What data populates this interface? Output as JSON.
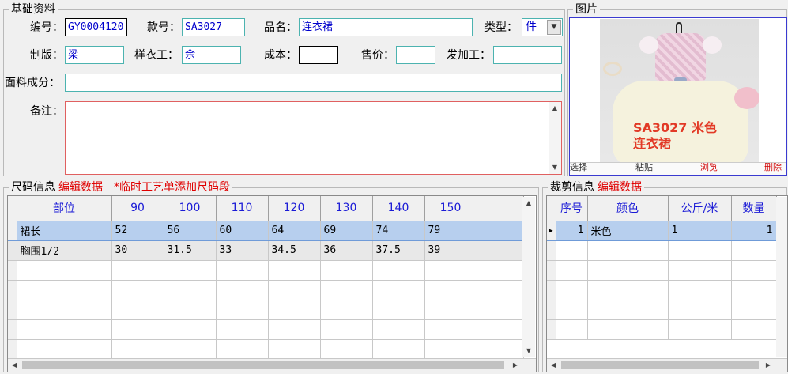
{
  "basic": {
    "title": "基础资料",
    "code_label": "编号：",
    "code_value": "GY0004120",
    "style_label": "款号：",
    "style_value": "SA3027",
    "name_label": "品名：",
    "name_value": "连衣裙",
    "type_label": "类型：",
    "type_value": "件",
    "pattern_label": "制版：",
    "pattern_value": "梁",
    "sample_label": "样衣工：",
    "sample_value": "余",
    "cost_label": "成本：",
    "cost_value": "",
    "price_label": "售价：",
    "price_value": "",
    "processor_label": "发加工：",
    "processor_value": "",
    "fabric_label": "面料成分：",
    "fabric_value": "",
    "notes_label": "备注：",
    "notes_value": ""
  },
  "photo": {
    "title": "图片",
    "caption_line1": "SA3027  米色",
    "caption_line2": "连衣裙",
    "buttons": {
      "select": "选择",
      "paste": "粘贴",
      "browse": "浏览",
      "delete": "删除"
    }
  },
  "size_info": {
    "title": "尺码信息",
    "edit_link": "编辑数据",
    "note": "*临时工艺单添加尺码段",
    "columns": [
      "部位",
      "90",
      "100",
      "110",
      "120",
      "130",
      "140",
      "150"
    ],
    "rows": [
      [
        "裙长",
        "52",
        "56",
        "60",
        "64",
        "69",
        "74",
        "79"
      ],
      [
        "胸围1/2",
        "30",
        "31.5",
        "33",
        "34.5",
        "36",
        "37.5",
        "39"
      ]
    ]
  },
  "cut_info": {
    "title": "裁剪信息",
    "edit_link": "编辑数据",
    "columns": [
      "序号",
      "颜色",
      "公斤/米",
      "数量"
    ],
    "rows": [
      [
        "1",
        "米色",
        "1",
        "1"
      ]
    ]
  },
  "colors": {
    "accent_red": "#e00000",
    "field_border": "#4cb3b0",
    "header_text": "#1a1ad6",
    "selected_row": "#b7cfee"
  }
}
